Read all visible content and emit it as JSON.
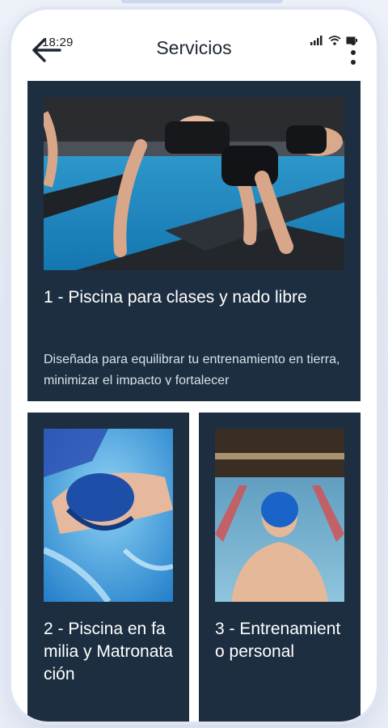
{
  "status_bar": {
    "time": "18:29"
  },
  "header": {
    "title": "Servicios",
    "back_icon": "arrow-left-icon",
    "menu_icon": "more-vertical-icon"
  },
  "services": [
    {
      "title": "1 - Piscina para clases y nado libre",
      "description": "Diseñada para equilibrar tu entrenamiento en tierra, minimizar el impacto y fortalecer"
    },
    {
      "title": "2 - Piscina en familia y Matronatación",
      "description": ""
    },
    {
      "title": "3 - Entrenamiento personal",
      "description": ""
    }
  ],
  "colors": {
    "card_bg": "#1c2e40",
    "header_bg": "#ffffff",
    "text_dark": "#1f2733"
  }
}
